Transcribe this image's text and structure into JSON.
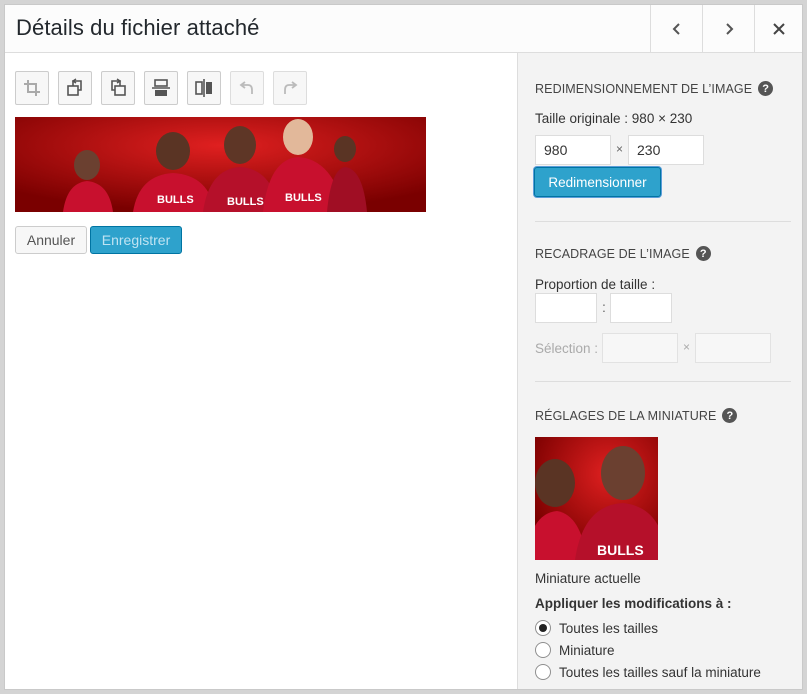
{
  "header": {
    "title": "Détails du fichier attaché"
  },
  "toolbar": {
    "tools": [
      "crop-icon",
      "rotate-left-icon",
      "rotate-right-icon",
      "flip-vertical-icon",
      "flip-horizontal-icon",
      "undo-icon",
      "redo-icon"
    ]
  },
  "actions": {
    "cancel_label": "Annuler",
    "save_label": "Enregistrer"
  },
  "resize": {
    "title": "REDIMENSIONNEMENT DE L’IMAGE",
    "original_size": "Taille originale : 980 × 230",
    "width": "980",
    "height": "230",
    "separator": "×",
    "button_label": "Redimensionner"
  },
  "crop": {
    "title": "RECADRAGE DE L’IMAGE",
    "ratio_label": "Proportion de taille :",
    "ratio_separator": ":",
    "selection_label": "Sélection :",
    "selection_separator": "×"
  },
  "thumbnail": {
    "title": "RÉGLAGES DE LA MINIATURE",
    "current_label": "Miniature actuelle",
    "apply_label": "Appliquer les modifications à :",
    "options": [
      {
        "label": "Toutes les tailles",
        "selected": true
      },
      {
        "label": "Miniature",
        "selected": false
      },
      {
        "label": "Toutes les tailles sauf la miniature",
        "selected": false
      }
    ]
  },
  "colors": {
    "primary": "#2ea2cc",
    "primary_border": "#0074a2",
    "sidebar_bg": "#f3f3f3"
  }
}
